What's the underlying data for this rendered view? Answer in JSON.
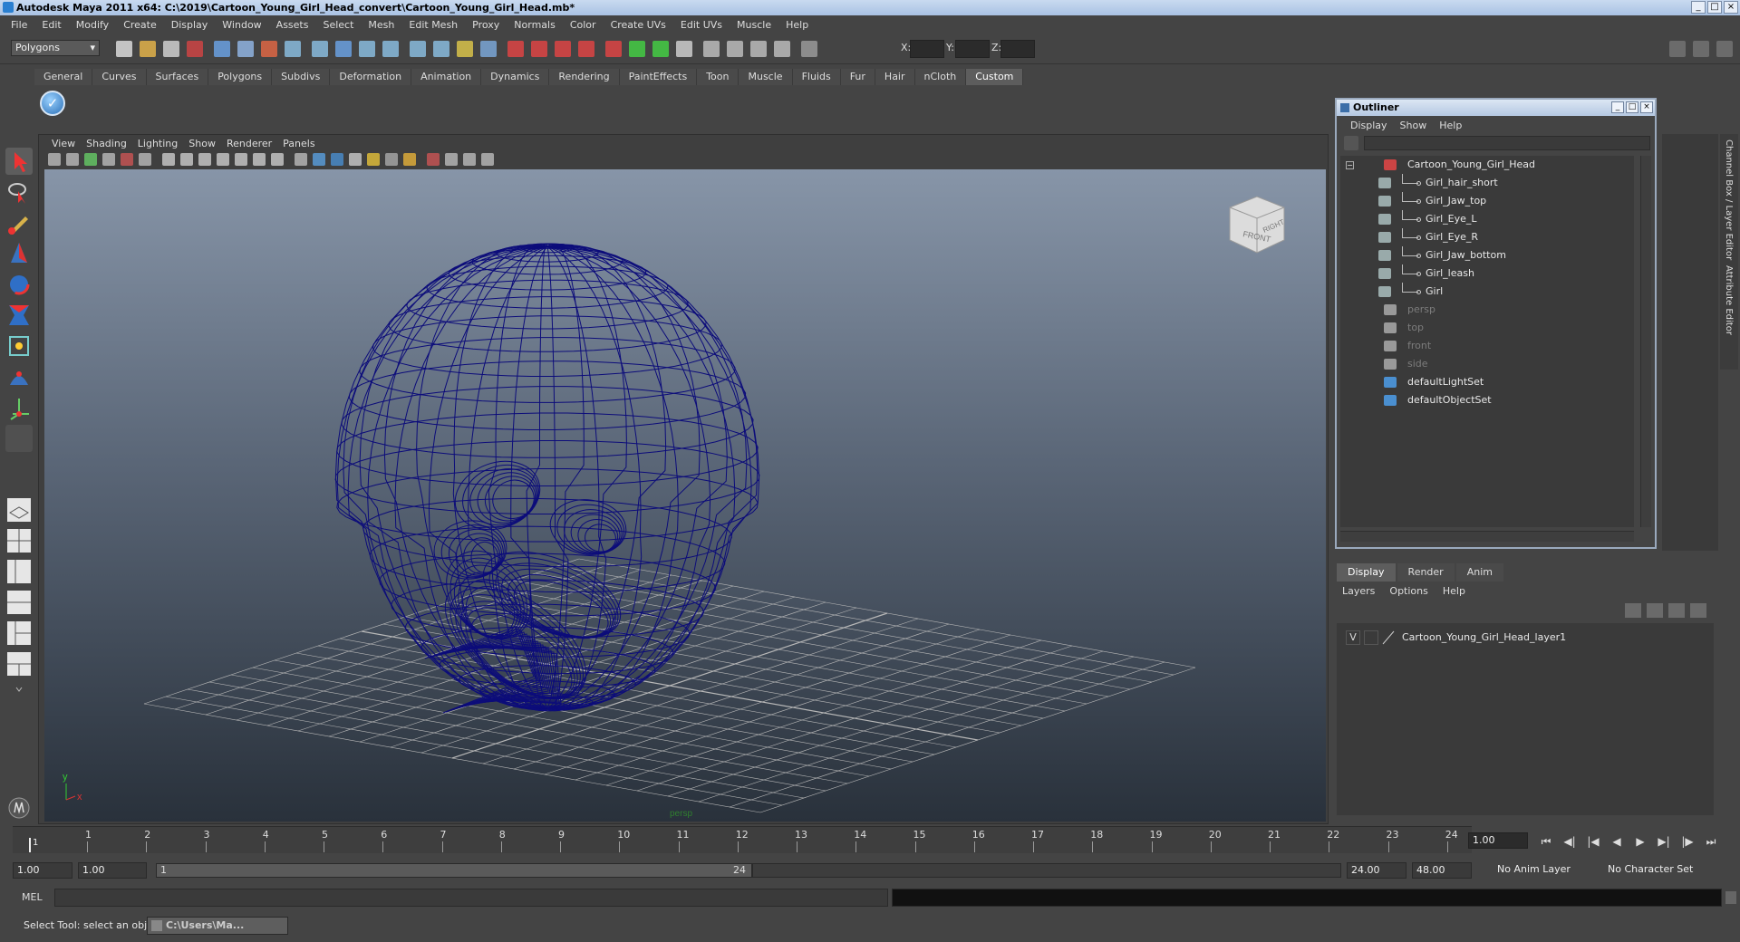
{
  "window": {
    "title": "Autodesk Maya 2011 x64: C:\\2019\\Cartoon_Young_Girl_Head_convert\\Cartoon_Young_Girl_Head.mb*"
  },
  "menu": [
    "File",
    "Edit",
    "Modify",
    "Create",
    "Display",
    "Window",
    "Assets",
    "Select",
    "Mesh",
    "Edit Mesh",
    "Proxy",
    "Normals",
    "Color",
    "Create UVs",
    "Edit UVs",
    "Muscle",
    "Help"
  ],
  "status_line": {
    "mode": "Polygons",
    "x_label": "X:",
    "y_label": "Y:",
    "z_label": "Z:"
  },
  "shelf_tabs": [
    "General",
    "Curves",
    "Surfaces",
    "Polygons",
    "Subdivs",
    "Deformation",
    "Animation",
    "Dynamics",
    "Rendering",
    "PaintEffects",
    "Toon",
    "Muscle",
    "Fluids",
    "Fur",
    "Hair",
    "nCloth",
    "Custom"
  ],
  "shelf_active": "Custom",
  "panel_menu": [
    "View",
    "Shading",
    "Lighting",
    "Show",
    "Renderer",
    "Panels"
  ],
  "viewcube": {
    "front": "FRONT",
    "right": "RIGHT"
  },
  "axis": {
    "x": "x",
    "y": "y"
  },
  "viewport_camera": "persp",
  "outliner": {
    "title": "Outliner",
    "menu": [
      "Display",
      "Show",
      "Help"
    ],
    "items": [
      {
        "label": "Cartoon_Young_Girl_Head",
        "depth": 0,
        "dim": false,
        "icon": "group-icon"
      },
      {
        "label": "Girl_hair_short",
        "depth": 1,
        "dim": false,
        "icon": "mesh-icon"
      },
      {
        "label": "Girl_Jaw_top",
        "depth": 1,
        "dim": false,
        "icon": "mesh-icon"
      },
      {
        "label": "Girl_Eye_L",
        "depth": 1,
        "dim": false,
        "icon": "mesh-icon"
      },
      {
        "label": "Girl_Eye_R",
        "depth": 1,
        "dim": false,
        "icon": "mesh-icon"
      },
      {
        "label": "Girl_Jaw_bottom",
        "depth": 1,
        "dim": false,
        "icon": "mesh-icon"
      },
      {
        "label": "Girl_leash",
        "depth": 1,
        "dim": false,
        "icon": "mesh-icon"
      },
      {
        "label": "Girl",
        "depth": 1,
        "dim": false,
        "icon": "mesh-icon"
      },
      {
        "label": "persp",
        "depth": 0,
        "dim": true,
        "icon": "camera-icon"
      },
      {
        "label": "top",
        "depth": 0,
        "dim": true,
        "icon": "camera-icon"
      },
      {
        "label": "front",
        "depth": 0,
        "dim": true,
        "icon": "camera-icon"
      },
      {
        "label": "side",
        "depth": 0,
        "dim": true,
        "icon": "camera-icon"
      },
      {
        "label": "defaultLightSet",
        "depth": 0,
        "dim": false,
        "icon": "set-icon"
      },
      {
        "label": "defaultObjectSet",
        "depth": 0,
        "dim": false,
        "icon": "set-icon"
      }
    ]
  },
  "layer_editor": {
    "tabs": [
      "Display",
      "Render",
      "Anim"
    ],
    "active_tab": "Display",
    "menu": [
      "Layers",
      "Options",
      "Help"
    ],
    "layers": [
      {
        "visible": "V",
        "name": "Cartoon_Young_Girl_Head_layer1"
      }
    ]
  },
  "right_tabs": [
    "Channel Box / Layer Editor",
    "Attribute Editor"
  ],
  "timeline": {
    "ticks": [
      "1",
      "2",
      "3",
      "4",
      "5",
      "6",
      "7",
      "8",
      "9",
      "10",
      "11",
      "12",
      "13",
      "14",
      "15",
      "16",
      "17",
      "18",
      "19",
      "20",
      "21",
      "22",
      "23",
      "24"
    ],
    "current_marker": "1",
    "current_frame": "1.00"
  },
  "range": {
    "start": "1.00",
    "play_start": "1.00",
    "slider_start": "1",
    "slider_end": "24",
    "play_end": "24.00",
    "end": "48.00",
    "anim_layer": "No Anim Layer",
    "character_set": "No Character Set"
  },
  "command_line": {
    "label": "MEL"
  },
  "status_bar": {
    "help_text": "Select Tool: select an object",
    "task_label": "C:\\Users\\Ma..."
  },
  "colors": {
    "wire": "#0c0c7a",
    "grid": "#b8b8b8",
    "viewport_top": "#8795a8",
    "viewport_bottom": "#29313b"
  }
}
